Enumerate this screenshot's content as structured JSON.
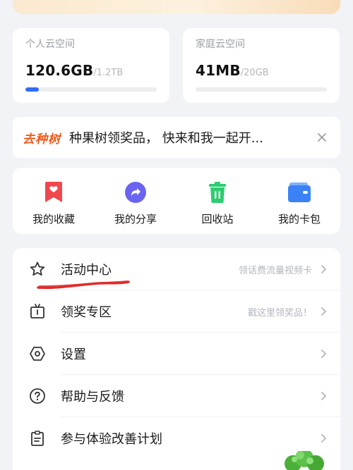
{
  "storage": {
    "personal": {
      "title": "个人云空间",
      "used": "120.6GB",
      "total": "/1.2TB",
      "progress": 0.1
    },
    "family": {
      "title": "家庭云空间",
      "used": "41MB",
      "total": "/20GB",
      "progress": 0.0
    }
  },
  "promo": {
    "tag": "去种树",
    "text": "种果树领奖品， 快来和我一起开..."
  },
  "quick": [
    {
      "label": "我的收藏",
      "icon": "bookmark-icon",
      "color": "#f0484c"
    },
    {
      "label": "我的分享",
      "icon": "share-icon",
      "color": "#6a64f0"
    },
    {
      "label": "回收站",
      "icon": "trash-icon",
      "color": "#2ecc6f"
    },
    {
      "label": "我的卡包",
      "icon": "wallet-icon",
      "color": "#3b82f6"
    }
  ],
  "list": [
    {
      "label": "活动中心",
      "hint": "领话费流量视频卡",
      "icon": "star-icon"
    },
    {
      "label": "领奖专区",
      "hint": "戳这里领奖品！",
      "icon": "gift-icon"
    },
    {
      "label": "设置",
      "hint": "",
      "icon": "settings-icon"
    },
    {
      "label": "帮助与反馈",
      "hint": "",
      "icon": "help-icon"
    },
    {
      "label": "参与体验改善计划",
      "hint": "",
      "icon": "clipboard-icon"
    }
  ],
  "colors": {
    "accent": "#2f6df6",
    "promo": "#f25a1b",
    "annotation": "#e02a2a"
  }
}
